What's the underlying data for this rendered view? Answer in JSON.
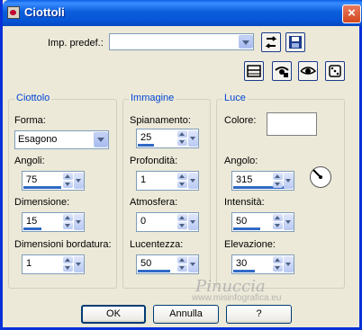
{
  "window": {
    "title": "Ciottoli",
    "close_glyph": "×"
  },
  "preset": {
    "label": "Imp. predef.:",
    "value": ""
  },
  "groups": {
    "ciottolo": {
      "title": "Ciottolo",
      "forma_label": "Forma:",
      "forma_value": "Esagono",
      "angoli_label": "Angoli:",
      "angoli_value": "75",
      "dimensione_label": "Dimensione:",
      "dimensione_value": "15",
      "bordatura_label": "Dimensioni bordatura:",
      "bordatura_value": "1"
    },
    "immagine": {
      "title": "Immagine",
      "spianamento_label": "Spianamento:",
      "spianamento_value": "25",
      "profondita_label": "Profondità:",
      "profondita_value": "1",
      "atmosfera_label": "Atmosfera:",
      "atmosfera_value": "0",
      "lucentezza_label": "Lucentezza:",
      "lucentezza_value": "50"
    },
    "luce": {
      "title": "Luce",
      "colore_label": "Colore:",
      "angolo_label": "Angolo:",
      "angolo_value": "315",
      "intensita_label": "Intensità:",
      "intensita_value": "50",
      "elevazione_label": "Elevazione:",
      "elevazione_value": "30"
    }
  },
  "buttons": {
    "ok": "OK",
    "cancel": "Annulla",
    "help": "?"
  },
  "watermark": {
    "name": "Pinuccia",
    "site": "www.misinfografica.eu"
  },
  "colors": {
    "title_bar": "#0a5fe6",
    "group_title": "#0046d5",
    "slider_fill": "#316ac5",
    "light_color": "#ffffff"
  },
  "icons": [
    "save-icon",
    "reset-icon",
    "toggle-preview-icon",
    "proof-icon",
    "eye-icon",
    "random-dice-icon"
  ]
}
